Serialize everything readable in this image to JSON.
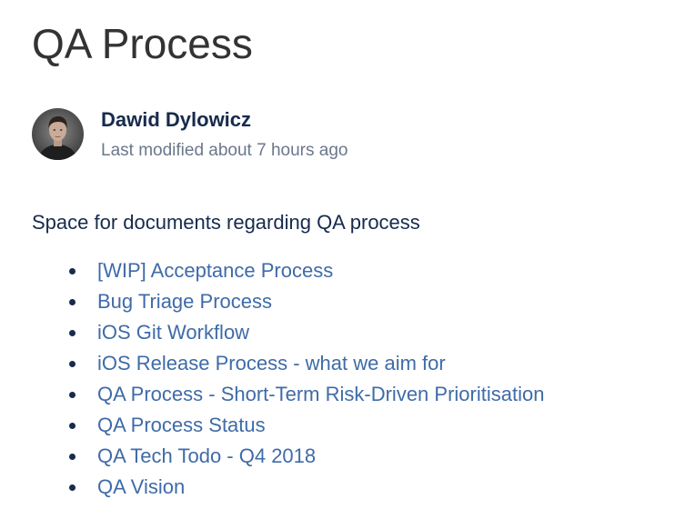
{
  "page": {
    "title": "QA Process"
  },
  "byline": {
    "author": "Dawid Dylowicz",
    "last_modified": "Last modified about 7 hours ago"
  },
  "content": {
    "description": "Space for documents regarding QA process",
    "links": [
      {
        "label": "[WIP] Acceptance Process"
      },
      {
        "label": "Bug Triage Process"
      },
      {
        "label": "iOS Git Workflow"
      },
      {
        "label": "iOS Release Process - what we aim for"
      },
      {
        "label": "QA Process - Short-Term Risk-Driven Prioritisation"
      },
      {
        "label": "QA Process Status"
      },
      {
        "label": "QA Tech Todo - Q4 2018"
      },
      {
        "label": "QA Vision"
      }
    ]
  },
  "colors": {
    "text": "#172b4d",
    "title": "#333333",
    "muted": "#6b778c",
    "link": "#3f6ba8"
  }
}
